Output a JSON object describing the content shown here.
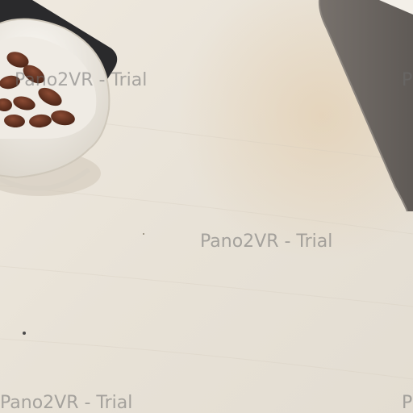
{
  "photo": {
    "colors": {
      "table": "#e9e3d8",
      "table_shadow": "#d8cfc1",
      "bowl": "#f2efe9",
      "bowl_shadow": "#cfc8bb",
      "nuts": "#6b3624",
      "laptop": "#6f6a66",
      "laptop_edge": "#8a847e",
      "phone": "#2a2a2c"
    },
    "objects": [
      "smartphone",
      "bowl-of-nuts",
      "laptop",
      "wooden-table"
    ]
  },
  "watermark": {
    "text": "Pano2VR - Trial",
    "partial_text": "P"
  }
}
